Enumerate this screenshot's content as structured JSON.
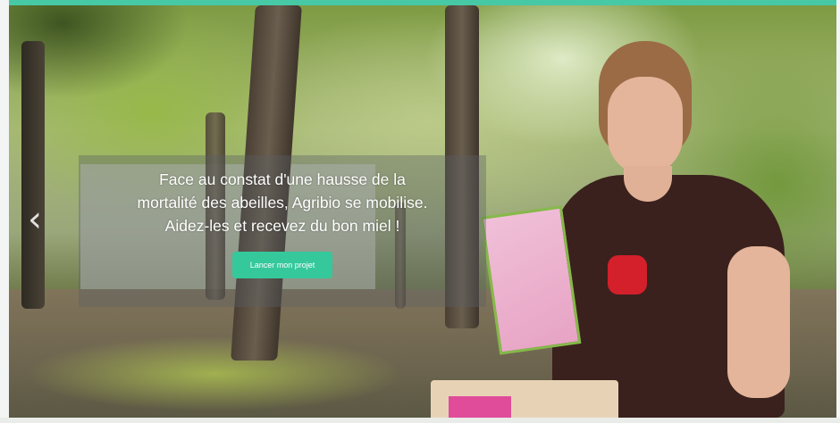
{
  "hero": {
    "headline_lines": [
      "Face au constat d'une hausse de la",
      "mortalité des abeilles, Agribio se mobilise.",
      "Aidez-les et recevez du bon miel !"
    ],
    "cta_label": "Lancer mon projet",
    "prev_arrow_icon": "chevron-left-icon"
  },
  "colors": {
    "accent": "#47c9a5",
    "cta_background": "#35c89b",
    "headline_text": "#ffffff"
  }
}
